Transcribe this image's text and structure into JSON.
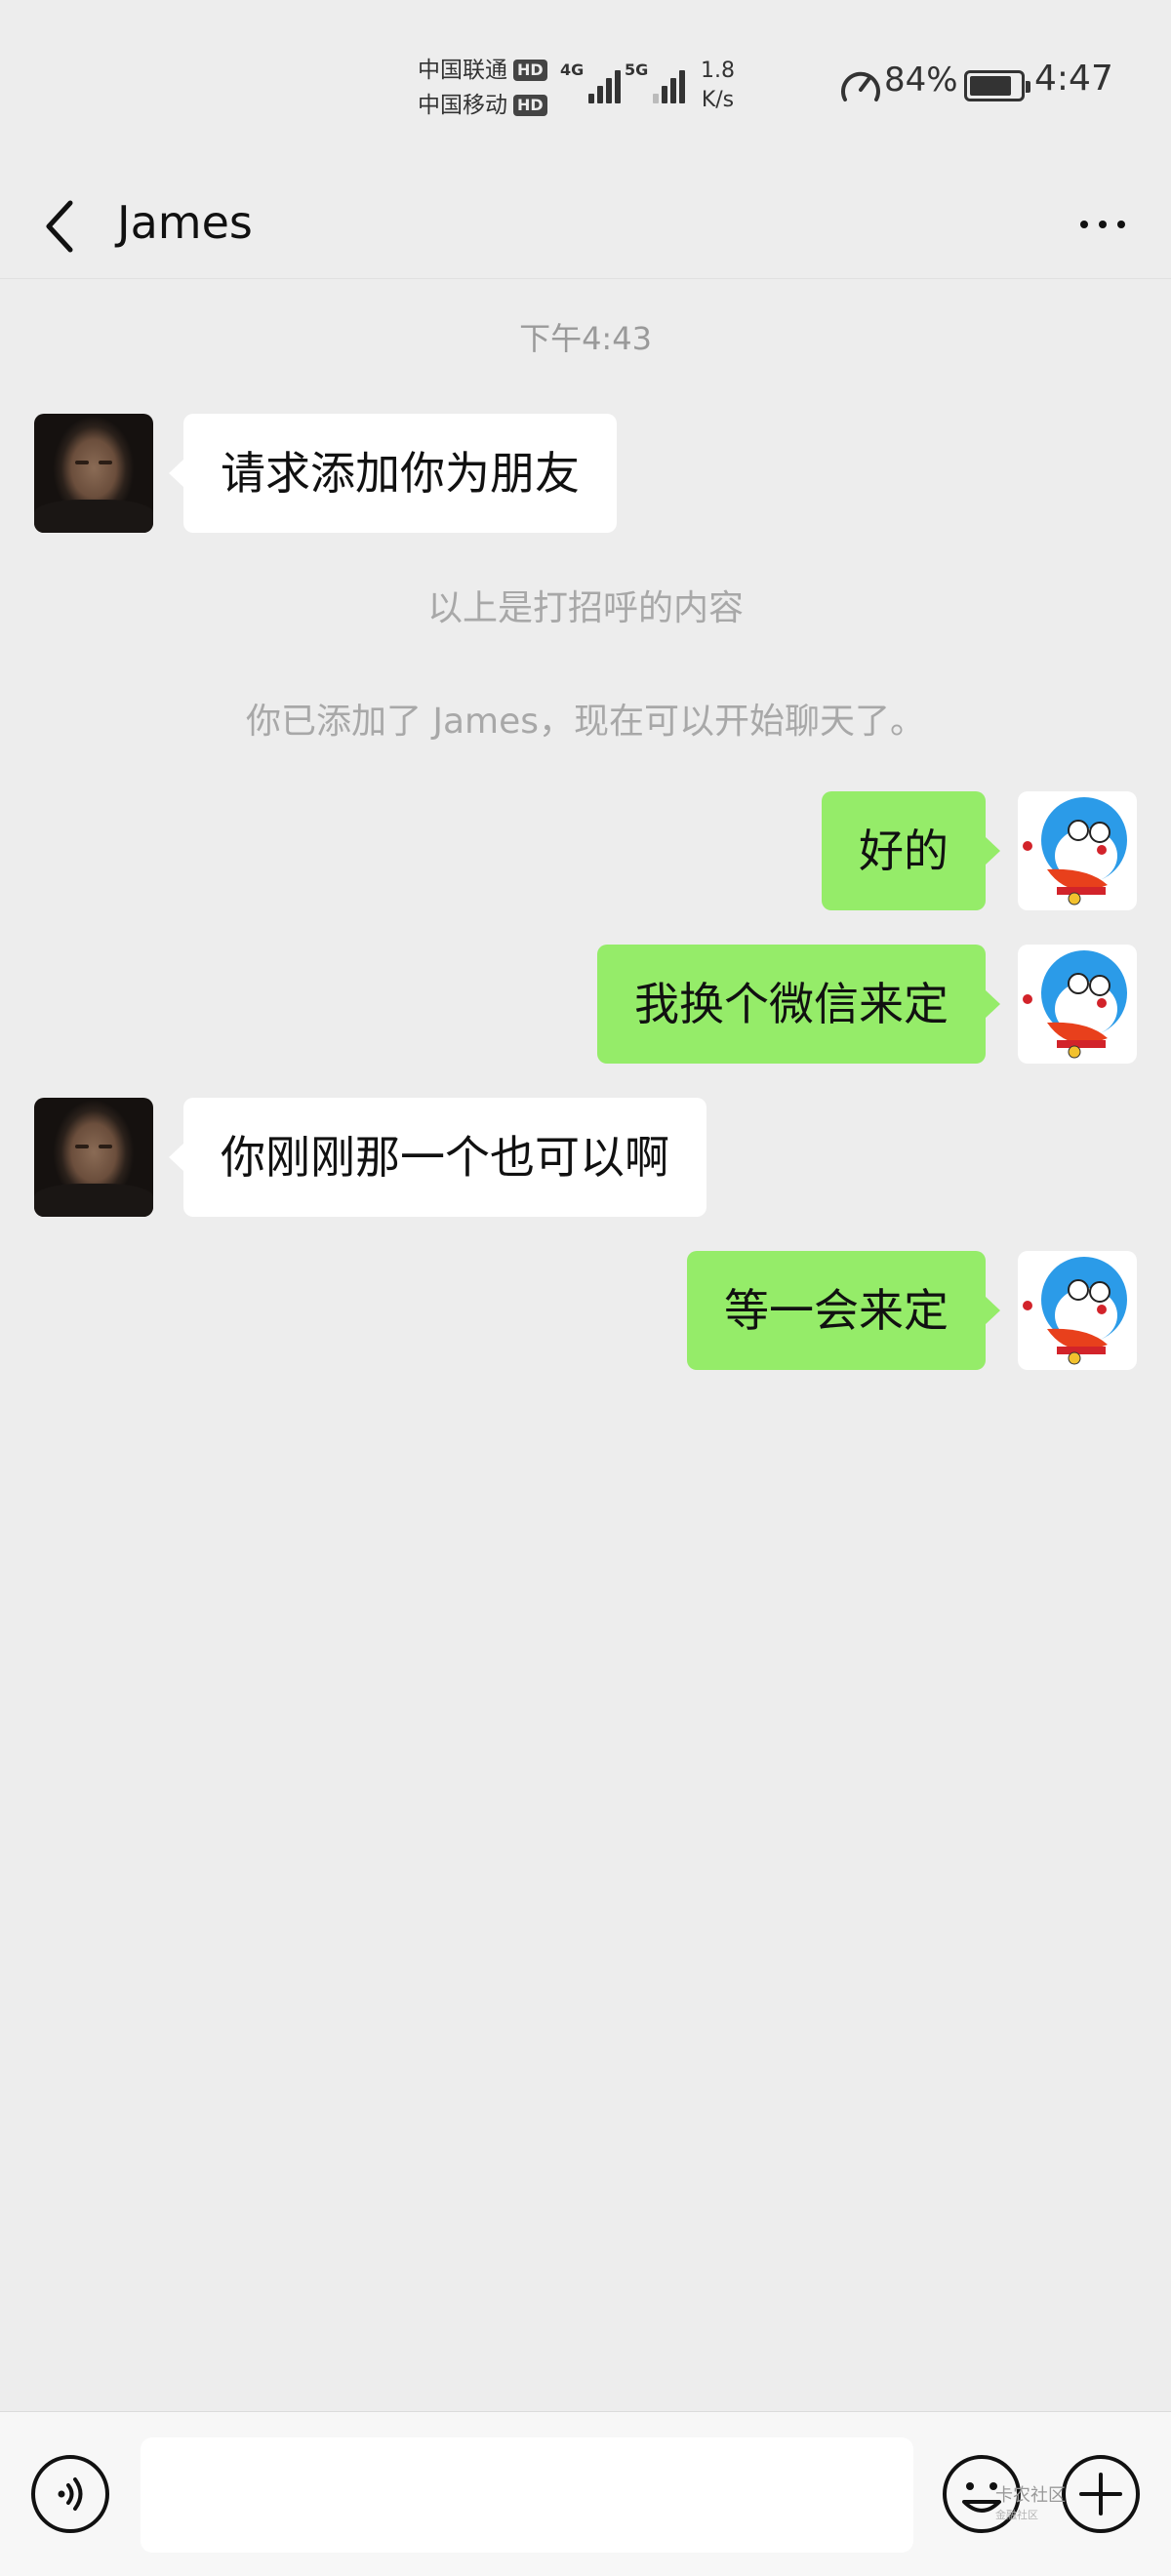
{
  "status_bar": {
    "carriers": [
      {
        "name": "中国联通",
        "badge": "HD"
      },
      {
        "name": "中国移动",
        "badge": "HD"
      }
    ],
    "signal_labels": [
      "4G",
      "5G"
    ],
    "net_speed_value": "1.8",
    "net_speed_unit": "K/s",
    "battery_percent": "84%",
    "battery_level": 0.84,
    "time": "4:47"
  },
  "header": {
    "title": "James"
  },
  "chat": {
    "timestamp": "下午4:43",
    "messages": [
      {
        "side": "left",
        "text": "请求添加你为朋友"
      },
      {
        "side": "right",
        "text": "好的"
      },
      {
        "side": "right",
        "text": "我换个微信来定"
      },
      {
        "side": "left",
        "text": "你刚刚那一个也可以啊"
      },
      {
        "side": "right",
        "text": "等一会来定"
      }
    ],
    "system_notes": [
      "以上是打招呼的内容",
      "你已添加了 James，现在可以开始聊天了。"
    ]
  },
  "input": {
    "value": "",
    "placeholder": ""
  },
  "watermark": {
    "title": "卡农社区",
    "subtitle": "金融社区"
  },
  "colors": {
    "background": "#ededed",
    "sent_bubble": "#95ec69",
    "received_bubble": "#ffffff",
    "input_bar": "#f7f7f7"
  }
}
